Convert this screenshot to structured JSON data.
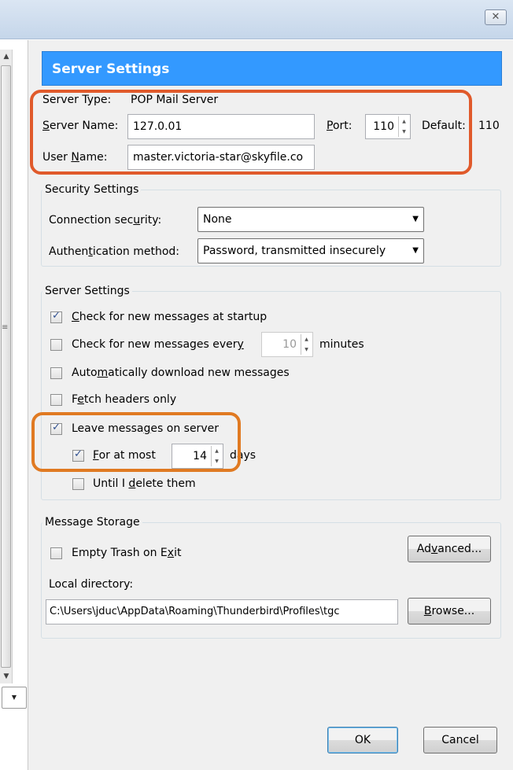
{
  "window": {
    "close_glyph": "✕"
  },
  "header": {
    "title": "Server Settings"
  },
  "server": {
    "type_label": "Server Type:",
    "type_value": "POP Mail Server",
    "name_label_pre": "",
    "name_label_ul": "S",
    "name_label_post": "erver Name:",
    "name_value": "127.0.01",
    "port_label_ul": "P",
    "port_label_post": "ort:",
    "port_value": "110",
    "default_label": "Default:",
    "default_value": "110",
    "user_label_pre": "User ",
    "user_label_ul": "N",
    "user_label_post": "ame:",
    "user_value": "master.victoria-star@skyfile.co"
  },
  "security": {
    "group_label": "Security Settings",
    "conn_label_pre": "Connection sec",
    "conn_label_ul": "u",
    "conn_label_post": "rity:",
    "conn_value": "None",
    "auth_label_pre": "Authen",
    "auth_label_ul": "t",
    "auth_label_post": "ication method:",
    "auth_value": "Password, transmitted insecurely"
  },
  "settings": {
    "group_label": "Server Settings",
    "check_startup_ul": "C",
    "check_startup_post": "heck for new messages at startup",
    "check_every_pre": "Check for new messages ever",
    "check_every_ul": "y",
    "check_every_value": "10",
    "minutes_label": "minutes",
    "auto_download_pre": "Auto",
    "auto_download_ul": "m",
    "auto_download_post": "atically download new messages",
    "fetch_headers_pre": "F",
    "fetch_headers_ul": "e",
    "fetch_headers_post": "tch headers only",
    "leave_pre": "Leave messa",
    "leave_ul": "g",
    "leave_post": "es on server",
    "for_at_most_ul": "F",
    "for_at_most_post": "or at most",
    "days_value": "14",
    "days_label": "days",
    "until_delete_pre": "Until I ",
    "until_delete_ul": "d",
    "until_delete_post": "elete them"
  },
  "storage": {
    "group_label": "Message Storage",
    "empty_trash_pre": "Empty Trash on E",
    "empty_trash_ul": "x",
    "empty_trash_post": "it",
    "advanced_pre": "Ad",
    "advanced_ul": "v",
    "advanced_post": "anced...",
    "local_dir_label": "Local directory:",
    "local_dir_value": "C:\\Users\\jduc\\AppData\\Roaming\\Thunderbird\\Profiles\\tgc",
    "browse_ul": "B",
    "browse_post": "rowse..."
  },
  "footer": {
    "ok_label": "OK",
    "cancel_label": "Cancel"
  },
  "checks": {
    "startup": true,
    "every": false,
    "auto": false,
    "headers": false,
    "leave": true,
    "at_most": true,
    "until_delete": false,
    "empty_trash": false
  },
  "colors": {
    "header_bg": "#3399ff",
    "highlight_red": "#e05a2b",
    "highlight_orange": "#e07a22"
  },
  "icons": {
    "close": "close-icon",
    "scroll_up": "arrow-up-icon",
    "scroll_down": "arrow-down-icon",
    "dropdown": "chevron-down-icon"
  }
}
